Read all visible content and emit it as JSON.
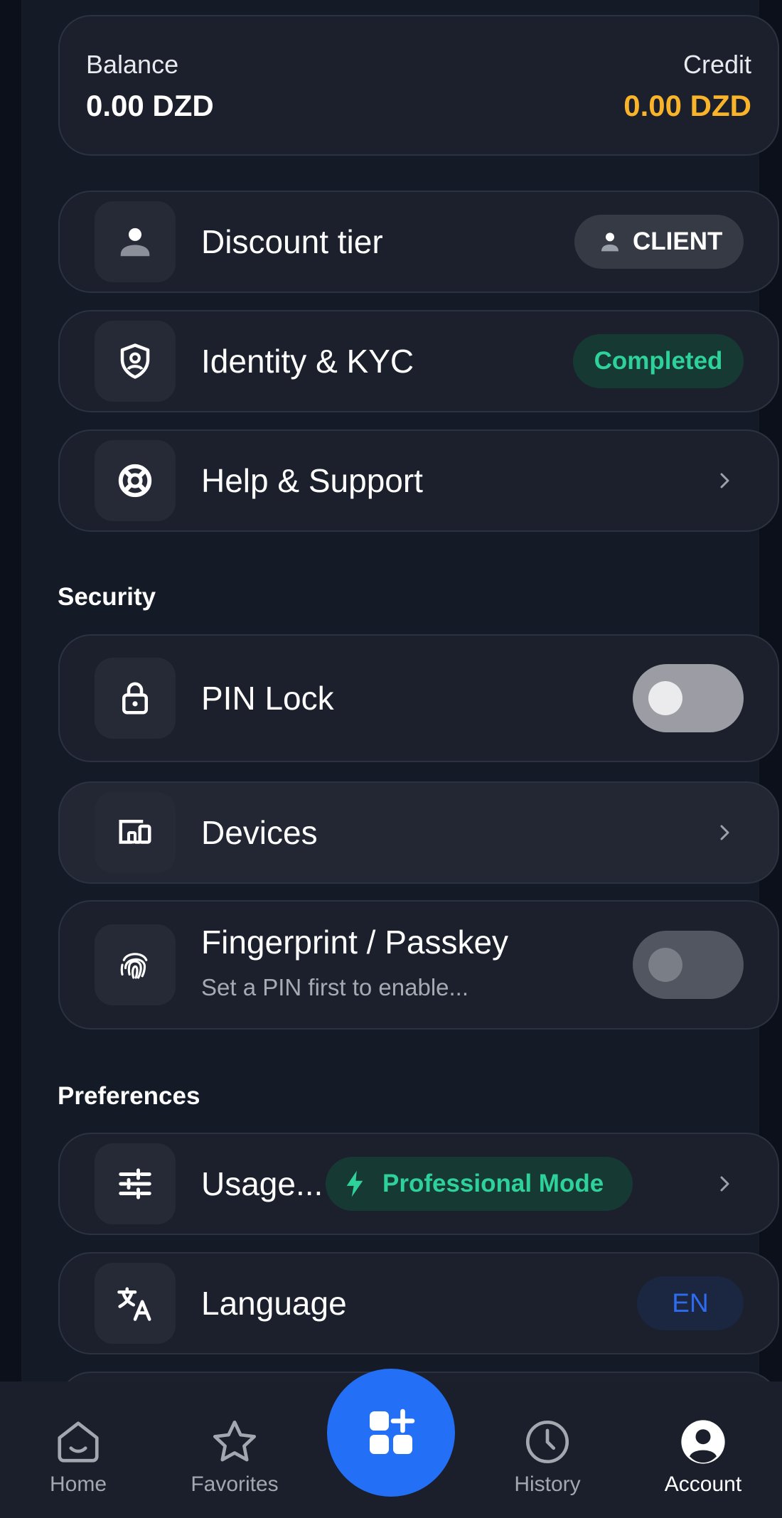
{
  "balance": {
    "balance_label": "Balance",
    "balance_value": "0.00 DZD",
    "credit_label": "Credit",
    "credit_value": "0.00 DZD",
    "credit_color": "#f9b42a"
  },
  "account_items": {
    "discount_tier": {
      "label": "Discount tier",
      "icon": "user-icon",
      "badge": "CLIENT"
    },
    "identity": {
      "label": "Identity & KYC",
      "icon": "shield-user-icon",
      "badge": "Completed",
      "badge_color": "#2ed19a"
    },
    "help": {
      "label": "Help & Support",
      "icon": "lifebuoy-icon"
    }
  },
  "security": {
    "title": "Security",
    "pin_lock": {
      "label": "PIN Lock",
      "icon": "lock-icon",
      "enabled": false
    },
    "devices": {
      "label": "Devices",
      "icon": "devices-icon"
    },
    "fingerprint": {
      "label": "Fingerprint / Passkey",
      "sublabel": "Set a PIN first to enable...",
      "icon": "fingerprint-icon",
      "enabled": false
    }
  },
  "preferences": {
    "title": "Preferences",
    "usage": {
      "label": "Usage...",
      "icon": "sliders-icon",
      "mode_badge": "Professional Mode"
    },
    "language": {
      "label": "Language",
      "icon": "translate-icon",
      "value": "EN"
    }
  },
  "bottom_nav": {
    "items": [
      {
        "label": "Home",
        "icon": "home-icon",
        "active": false
      },
      {
        "label": "Favorites",
        "icon": "star-icon",
        "active": false
      },
      {
        "label": "History",
        "icon": "clock-icon",
        "active": false
      },
      {
        "label": "Account",
        "icon": "account-icon",
        "active": true
      }
    ],
    "fab_icon": "add-widget-icon",
    "accent_color": "#2370f7"
  }
}
